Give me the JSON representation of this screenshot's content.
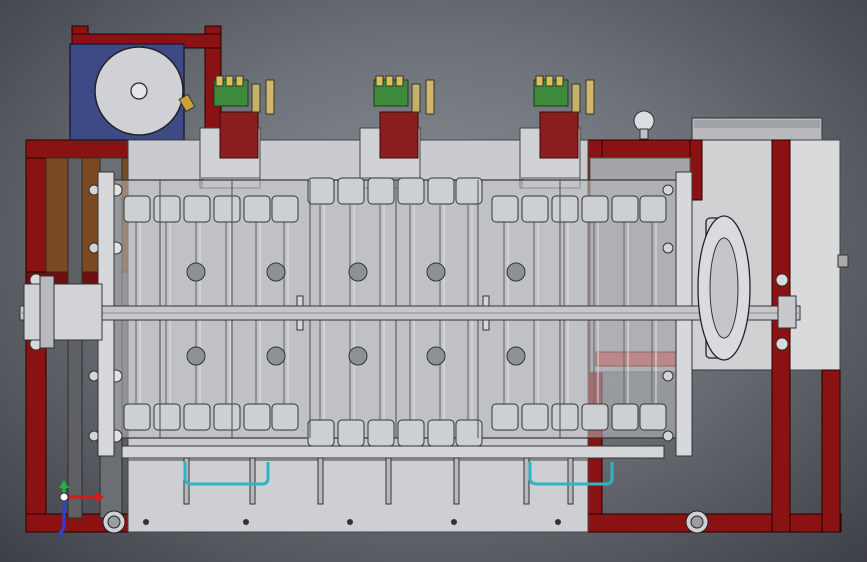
{
  "viewport": {
    "title": "",
    "background_top": "#2e3136",
    "background_center": "#9a9ea4"
  },
  "colors": {
    "frame_red": "#8a1212",
    "frame_red_dark": "#5a0a0a",
    "sheet_metal": "#c9cbce",
    "sheet_metal_dark": "#a9acb0",
    "motor_blue": "#3e4a86",
    "bracket_brown": "#7a4a22",
    "valve_green": "#3d8a3a",
    "cable_cyan": "#2fb3c9"
  },
  "assembly": {
    "frame": "red-steel-frame",
    "drive_motor": "drive-motor",
    "chamber": "transparent-chamber",
    "main_shaft": "main-shaft",
    "pulley": "drive-pulley",
    "gearbox": "gearbox-housing",
    "tool_head_groups": 3
  },
  "axis_triad": {
    "x_label": "",
    "y_label": "",
    "z_label": "Z",
    "x_color": "#d31b1b",
    "y_color": "#1fb43a",
    "z_color": "#2a40d8"
  }
}
